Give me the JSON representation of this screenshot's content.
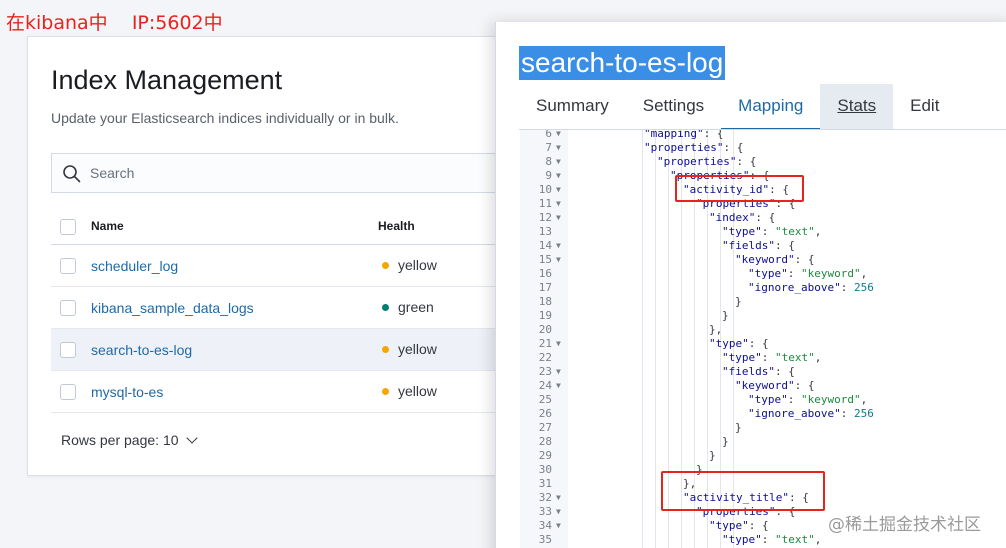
{
  "annotation": "在kibana中    IP:5602中",
  "index_management": {
    "title": "Index Management",
    "subtitle": "Update your Elasticsearch indices individually or in bulk.",
    "search": {
      "placeholder": "Search",
      "value": ""
    },
    "columns": {
      "name": "Name",
      "health": "Health"
    },
    "rows": [
      {
        "name": "scheduler_log",
        "health": "yellow",
        "health_color": "#f5a700",
        "selected": false
      },
      {
        "name": "kibana_sample_data_logs",
        "health": "green",
        "health_color": "#017d73",
        "selected": false
      },
      {
        "name": "search-to-es-log",
        "health": "yellow",
        "health_color": "#f5a700",
        "selected": true
      },
      {
        "name": "mysql-to-es",
        "health": "yellow",
        "health_color": "#f5a700",
        "selected": false
      }
    ],
    "rows_per_page": "Rows per page: 10"
  },
  "flyout": {
    "title": "search-to-es-log",
    "tabs": [
      {
        "label": "Summary",
        "state": "normal"
      },
      {
        "label": "Settings",
        "state": "normal"
      },
      {
        "label": "Mapping",
        "state": "active"
      },
      {
        "label": "Stats",
        "state": "hover"
      },
      {
        "label": "Edit settings",
        "state": "normal"
      }
    ],
    "code_lines": [
      {
        "n": "6",
        "fold": true,
        "indent": 6,
        "text": "\"mapping\": {"
      },
      {
        "n": "7",
        "fold": true,
        "indent": 6,
        "text": "\"properties\": {"
      },
      {
        "n": "8",
        "fold": true,
        "indent": 7,
        "text": "\"properties\": {"
      },
      {
        "n": "9",
        "fold": true,
        "indent": 8,
        "text": "\"properties\": {"
      },
      {
        "n": "10",
        "fold": true,
        "indent": 9,
        "text": "\"activity_id\": {"
      },
      {
        "n": "11",
        "fold": true,
        "indent": 10,
        "text": "\"properties\": {"
      },
      {
        "n": "12",
        "fold": true,
        "indent": 11,
        "text": "\"index\": {"
      },
      {
        "n": "13",
        "fold": false,
        "indent": 12,
        "text": "\"type\": \"text\","
      },
      {
        "n": "14",
        "fold": true,
        "indent": 12,
        "text": "\"fields\": {"
      },
      {
        "n": "15",
        "fold": true,
        "indent": 13,
        "text": "\"keyword\": {"
      },
      {
        "n": "16",
        "fold": false,
        "indent": 14,
        "text": "\"type\": \"keyword\","
      },
      {
        "n": "17",
        "fold": false,
        "indent": 14,
        "text": "\"ignore_above\": 256"
      },
      {
        "n": "18",
        "fold": false,
        "indent": 13,
        "text": "}"
      },
      {
        "n": "19",
        "fold": false,
        "indent": 12,
        "text": "}"
      },
      {
        "n": "20",
        "fold": false,
        "indent": 11,
        "text": "},"
      },
      {
        "n": "21",
        "fold": true,
        "indent": 11,
        "text": "\"type\": {"
      },
      {
        "n": "22",
        "fold": false,
        "indent": 12,
        "text": "\"type\": \"text\","
      },
      {
        "n": "23",
        "fold": true,
        "indent": 12,
        "text": "\"fields\": {"
      },
      {
        "n": "24",
        "fold": true,
        "indent": 13,
        "text": "\"keyword\": {"
      },
      {
        "n": "25",
        "fold": false,
        "indent": 14,
        "text": "\"type\": \"keyword\","
      },
      {
        "n": "26",
        "fold": false,
        "indent": 14,
        "text": "\"ignore_above\": 256"
      },
      {
        "n": "27",
        "fold": false,
        "indent": 13,
        "text": "}"
      },
      {
        "n": "28",
        "fold": false,
        "indent": 12,
        "text": "}"
      },
      {
        "n": "29",
        "fold": false,
        "indent": 11,
        "text": "}"
      },
      {
        "n": "30",
        "fold": false,
        "indent": 10,
        "text": "}"
      },
      {
        "n": "31",
        "fold": false,
        "indent": 9,
        "text": "},"
      },
      {
        "n": "32",
        "fold": true,
        "indent": 9,
        "text": "\"activity_title\": {"
      },
      {
        "n": "33",
        "fold": true,
        "indent": 10,
        "text": "\"properties\": {"
      },
      {
        "n": "34",
        "fold": true,
        "indent": 11,
        "text": "\"type\": {"
      },
      {
        "n": "35",
        "fold": false,
        "indent": 12,
        "text": "\"type\": \"text\","
      }
    ]
  },
  "watermark": "@稀土掘金技术社区",
  "colors": {
    "link": "#1d6aa8",
    "highlight_box": "#e8231c",
    "title_selection": "#3a8ee6"
  }
}
